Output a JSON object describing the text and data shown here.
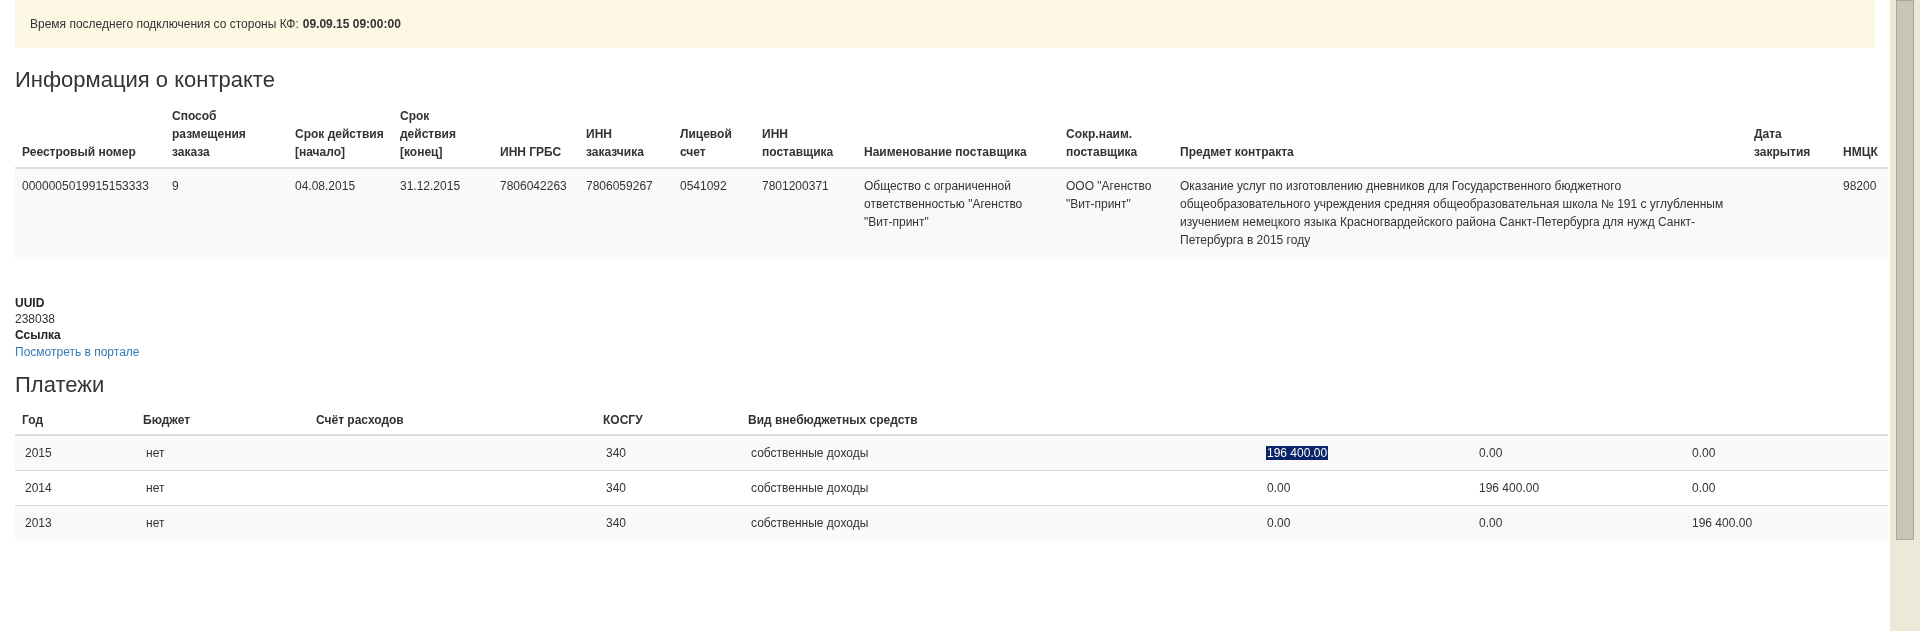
{
  "banner": {
    "label": "Время последнего подключения со стороны КФ:",
    "value": "09.09.15 09:00:00"
  },
  "contract": {
    "title": "Информация о контракте",
    "columns": [
      "Реестровый номер",
      "Способ размещения заказа",
      "Срок действия [начало]",
      "Срок действия [конец]",
      "ИНН ГРБС",
      "ИНН заказчика",
      "Лицевой счет",
      "ИНН поставщика",
      "Наименование поставщика",
      "Сокр.наим. поставщика",
      "Предмет контракта",
      "Дата закрытия",
      "НМЦК"
    ],
    "rows": [
      [
        "0000005019915153333",
        "9",
        "04.08.2015",
        "31.12.2015",
        "7806042263",
        "7806059267",
        "0541092",
        "7801200371",
        "Общество с ограниченной ответственностью \"Агенство \"Вит-принт\"",
        "ООО \"Агенство \"Вит-принт\"",
        "Оказание услуг по изготовлению дневников для Государственного бюджетного общеобразовательного учреждения средняя общеобразовательная школа № 191 с углубленным изучением немецкого языка Красногвардейского района Санкт-Петербурга для нужд Санкт-Петербурга в 2015 году",
        "",
        "98200"
      ]
    ]
  },
  "details": [
    {
      "label": "UUID",
      "value": "238038",
      "kind": "text"
    },
    {
      "label": "Ссылка",
      "value": "Посмотреть в портале",
      "kind": "link"
    }
  ],
  "payments": {
    "title": "Платежи",
    "columns": [
      "Год",
      "Бюджет",
      "Счёт расходов",
      "КОСГУ",
      "Вид внебюджетных средств"
    ],
    "rows": [
      {
        "year": "2015",
        "budget": "нет",
        "kosgu": "340",
        "fund_type": "собственные доходы",
        "amounts": [
          {
            "text": "196 400.00",
            "selected": true
          },
          {
            "text": "0.00",
            "selected": false
          },
          {
            "text": "0.00",
            "selected": false
          }
        ]
      },
      {
        "year": "2014",
        "budget": "нет",
        "kosgu": "340",
        "fund_type": "собственные доходы",
        "amounts": [
          {
            "text": "0.00",
            "selected": false
          },
          {
            "text": "196 400.00",
            "selected": false
          },
          {
            "text": "0.00",
            "selected": false
          }
        ]
      },
      {
        "year": "2013",
        "budget": "нет",
        "kosgu": "340",
        "fund_type": "собственные доходы",
        "amounts": [
          {
            "text": "0.00",
            "selected": false
          },
          {
            "text": "0.00",
            "selected": false
          },
          {
            "text": "196 400.00",
            "selected": false
          }
        ]
      }
    ]
  }
}
